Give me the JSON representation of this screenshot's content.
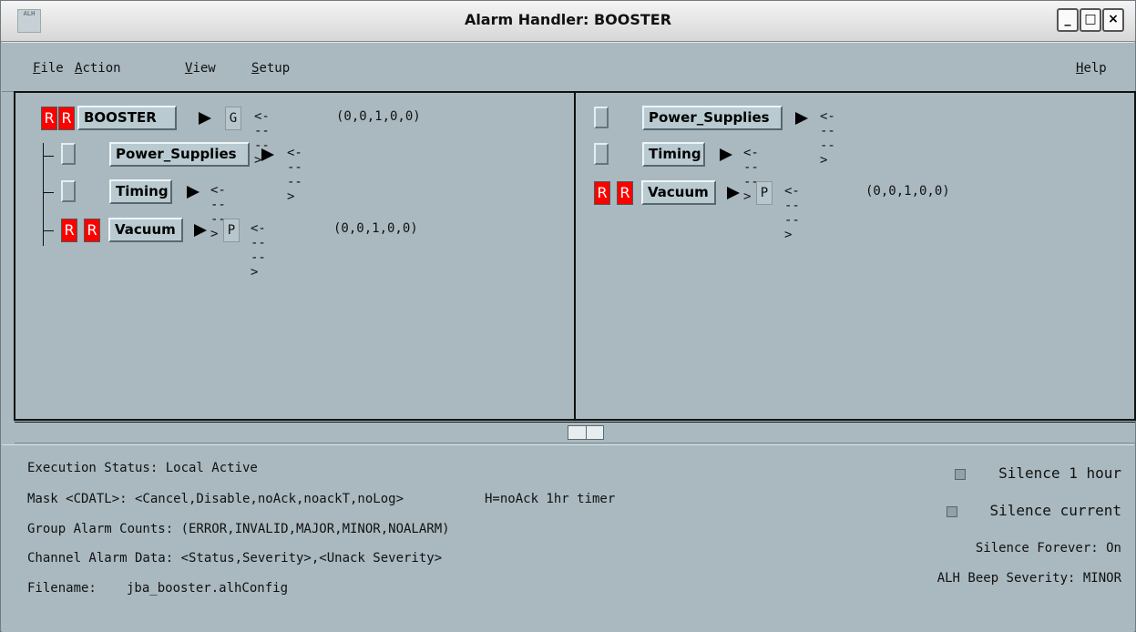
{
  "window": {
    "title": "Alarm Handler: BOOSTER",
    "app_icon_text": "ALH"
  },
  "menu": {
    "items": [
      {
        "label": "File",
        "accelerator": "F"
      },
      {
        "label": "Action",
        "accelerator": "A"
      },
      {
        "label": "View",
        "accelerator": "V"
      },
      {
        "label": "Setup",
        "accelerator": "S"
      }
    ],
    "help": "Help"
  },
  "left_tree": {
    "root": {
      "sev1": "R",
      "sev2": "R",
      "name": "BOOSTER",
      "mode": "G",
      "arrow_text": "<----->",
      "counts": "(0,0,1,0,0)"
    },
    "children": [
      {
        "name": "Power_Supplies",
        "arrow_text": "<----->"
      },
      {
        "name": "Timing",
        "arrow_text": "<----->"
      },
      {
        "sev1": "R",
        "sev2": "R",
        "name": "Vacuum",
        "mode": "P",
        "arrow_text": "<----->",
        "counts": "(0,0,1,0,0)"
      }
    ]
  },
  "right_tree": {
    "items": [
      {
        "name": "Power_Supplies",
        "arrow_text": "<----->"
      },
      {
        "name": "Timing",
        "arrow_text": "<----->"
      },
      {
        "sev1": "R",
        "sev2": "R",
        "name": "Vacuum",
        "mode": "P",
        "arrow_text": "<----->",
        "counts": "(0,0,1,0,0)"
      }
    ]
  },
  "status": {
    "execution": "Execution Status:  Local Active",
    "mask": "Mask <CDATL>:  <Cancel,Disable,noAck,noackT,noLog>",
    "mask_hint": "H=noAck 1hr timer",
    "group_counts": "Group Alarm Counts:  (ERROR,INVALID,MAJOR,MINOR,NOALARM)",
    "channel_data": "Channel Alarm Data:  <Status,Severity>,<Unack Severity>",
    "filename_label": "Filename:",
    "filename": "jba_booster.alhConfig",
    "silence_hour": "Silence 1 hour",
    "silence_current": "Silence current",
    "silence_forever": "Silence Forever:  On",
    "beep_severity": "ALH Beep Severity: MINOR"
  },
  "colors": {
    "background": "#a9b9bf",
    "alarm_red": "#ff0000",
    "text": "#111111"
  }
}
